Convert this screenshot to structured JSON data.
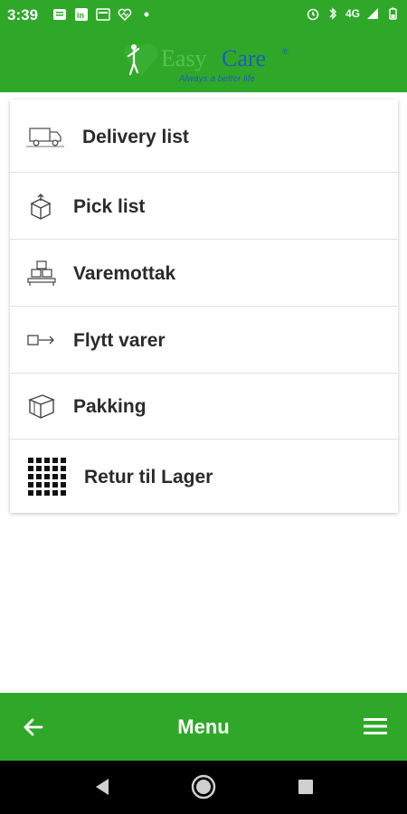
{
  "status_bar": {
    "time": "3:39",
    "left_icons": [
      "message-icon",
      "linkedin-icon",
      "news-icon",
      "heart-monitor-icon",
      "dot-icon"
    ],
    "right_icons": [
      "alarm-icon",
      "bluetooth-icon",
      "network-4g-icon",
      "signal-icon",
      "battery-icon"
    ],
    "network_label": "4G"
  },
  "header": {
    "logo_text_1": "Easy",
    "logo_text_2": "Care",
    "logo_reg": "®",
    "tagline": "Always a better life"
  },
  "menu": {
    "items": [
      {
        "label": "Delivery list",
        "icon": "delivery-truck-icon"
      },
      {
        "label": "Pick list",
        "icon": "pick-box-icon"
      },
      {
        "label": "Varemottak",
        "icon": "goods-receipt-icon"
      },
      {
        "label": "Flytt varer",
        "icon": "move-goods-icon"
      },
      {
        "label": "Pakking",
        "icon": "packing-box-icon"
      },
      {
        "label": "Retur til Lager",
        "icon": "grid-icon"
      }
    ]
  },
  "bottom_bar": {
    "title": "Menu",
    "back_icon": "arrow-left-icon",
    "menu_icon": "hamburger-icon"
  },
  "nav_bar": {
    "buttons": [
      "back-triangle-icon",
      "home-circle-icon",
      "recents-square-icon"
    ]
  },
  "colors": {
    "primary_green": "#2fa82a",
    "logo_blue": "#1d5fb5",
    "logo_green": "#55c24c",
    "text_dark": "#2a2a2a"
  }
}
